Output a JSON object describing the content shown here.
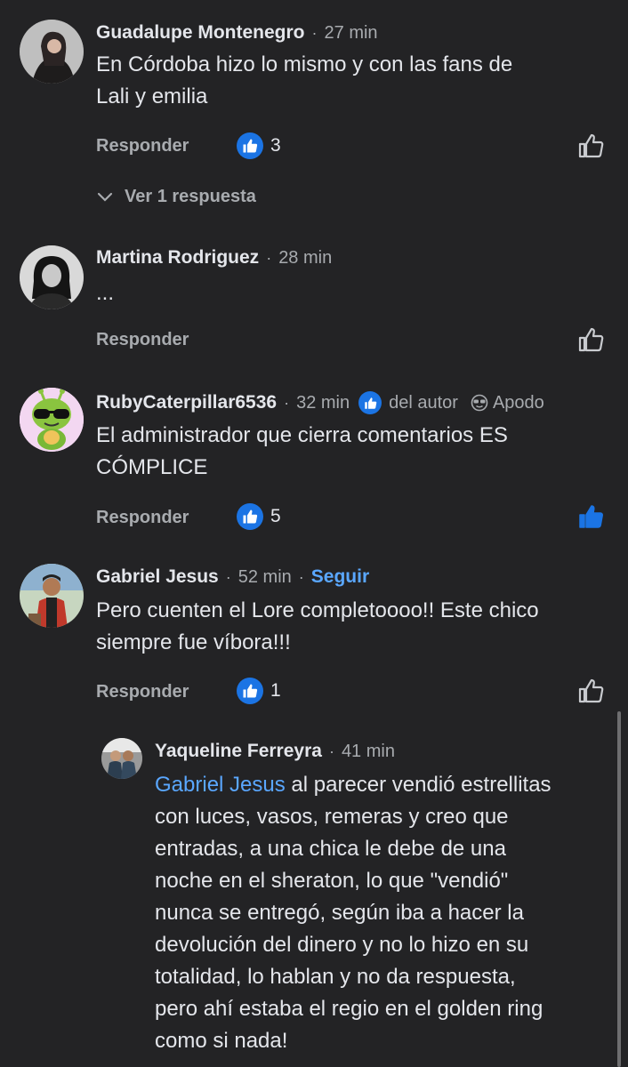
{
  "comments": [
    {
      "author": "Guadalupe Montenegro",
      "time": "27 min",
      "text_lines": [
        "En Córdoba hizo lo mismo y con las fans de",
        "Lali y emilia"
      ],
      "reply_label": "Responder",
      "reaction_count": "3",
      "view_replies": "Ver 1 respuesta"
    },
    {
      "author": "Martina Rodriguez",
      "time": "28 min",
      "text_lines": [
        "..."
      ],
      "reply_label": "Responder"
    },
    {
      "author": "RubyCaterpillar6536",
      "time": "32 min",
      "author_badge": "del autor",
      "nickname_badge": "Apodo",
      "text_lines": [
        "El administrador que cierra comentarios ES",
        "CÓMPLICE"
      ],
      "reply_label": "Responder",
      "reaction_count": "5",
      "liked_by_me": true
    },
    {
      "author": "Gabriel Jesus",
      "time": "52 min",
      "follow_label": "Seguir",
      "text_lines": [
        "Pero cuenten el Lore completoooo!! Este chico",
        "siempre fue víbora!!!"
      ],
      "reply_label": "Responder",
      "reaction_count": "1"
    }
  ],
  "reply": {
    "author": "Yaqueline Ferreyra",
    "time": "41 min",
    "mention": "Gabriel Jesus",
    "text_first_line_rest": " al parecer vendió estrellitas",
    "text_lines": [
      "con luces, vasos, remeras y creo que",
      "entradas, a una chica le debe de una",
      "noche en el sheraton, lo que \"vendió\"",
      "nunca se entregó, según iba a hacer la",
      "devolución del dinero y no lo hizo en su",
      "totalidad, lo hablan y no da respuesta,",
      "pero ahí estaba el regio en el golden ring",
      "como si nada!"
    ]
  },
  "colors": {
    "background": "#232325",
    "accent_blue": "#1b74e4",
    "link_blue": "#5aa7ff",
    "muted": "#a8abaf"
  }
}
